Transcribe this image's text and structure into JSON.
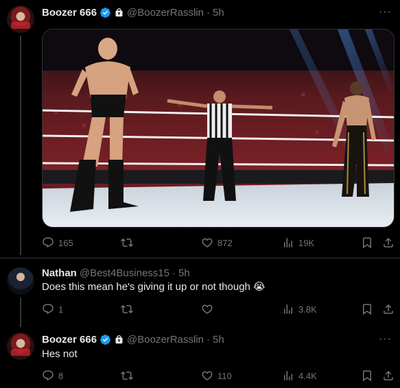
{
  "tweets": [
    {
      "name": "Boozer 666",
      "handle": "@BoozerRasslin",
      "time": "5h",
      "text": "",
      "has_media": true,
      "media_description_icon": "wrestling-ring-photo",
      "verified": true,
      "protected": true,
      "actions": {
        "replies": "165",
        "reposts": "",
        "likes": "872",
        "views": "19K"
      }
    },
    {
      "name": "Nathan",
      "handle": "@Best4Business15",
      "time": "5h",
      "text": "Does this mean he's giving it up or not though 😭",
      "verified": false,
      "protected": false,
      "actions": {
        "replies": "1",
        "reposts": "",
        "likes": "",
        "views": "3.8K"
      }
    },
    {
      "name": "Boozer 666",
      "handle": "@BoozerRasslin",
      "time": "5h",
      "text": "Hes not",
      "verified": true,
      "protected": true,
      "actions": {
        "replies": "8",
        "reposts": "",
        "likes": "110",
        "views": "4.4K"
      }
    }
  ],
  "separator": "·",
  "more_glyph": "···",
  "colors": {
    "background": "#000000",
    "text": "#e7e9ea",
    "muted": "#71767b",
    "verified": "#1d9bf0",
    "divider": "#2f3336"
  }
}
